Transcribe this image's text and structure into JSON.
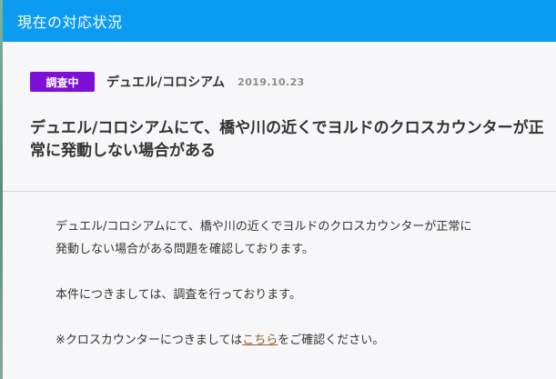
{
  "header": {
    "title": "現在の対応状況"
  },
  "notice": {
    "status_badge": "調査中",
    "category": "デュエル/コロシアム",
    "date": "2019.10.23",
    "title": "デュエル/コロシアムにて、橋や川の近くでヨルドのクロスカウンターが正常に発動しない場合がある"
  },
  "body": {
    "paragraph1_line1": "デュエル/コロシアムにて、橋や川の近くでヨルドのクロスカウンターが正常に",
    "paragraph1_line2": "発動しない場合がある問題を確認しております。",
    "paragraph2": "本件につきましては、調査を行っております。",
    "paragraph3_before": "※クロスカウンターにつきましては",
    "paragraph3_link": "こちら",
    "paragraph3_after": "をご確認ください。"
  }
}
